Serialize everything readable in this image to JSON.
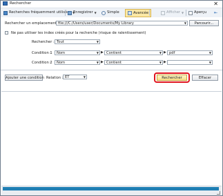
{
  "window": {
    "title": "Rechercher",
    "close_glyph": "✕"
  },
  "toolbar": {
    "recent": "Recherches fréquemment utilisées",
    "save": "Enregistrer",
    "simple": "Simple",
    "advanced": "Avancée",
    "display": "Afficher",
    "preview": "Aperçu",
    "pin_glyph": "⇤"
  },
  "search": {
    "location_label": "Rechercher un emplacement :",
    "location_value": "file:///C:/Users/user/Documents/My Library",
    "browse_button": "Parcourir...",
    "index_checkbox_label": "Ne pas utiliser les index créés pour la recherche (risque de ralentissement)",
    "scope_label": "Rechercher :",
    "scope_value": "Tout"
  },
  "conditions": [
    {
      "label": "Condition 1",
      "field": "Nom",
      "operator": "Contient",
      "value": "pdf"
    },
    {
      "label": "Condition 2",
      "field": "Nom",
      "operator": "Contient",
      "value": ""
    }
  ],
  "actions": {
    "add_condition": "Ajouter une condition",
    "relation_label": "Relation :",
    "relation_value": "ET",
    "search_button": "Rechercher",
    "clear_button": "Effacer"
  },
  "colors": {
    "accent_blue": "#1f7fb4",
    "active_tab": "#fbe8a6",
    "highlight_ring": "#e0141e"
  }
}
